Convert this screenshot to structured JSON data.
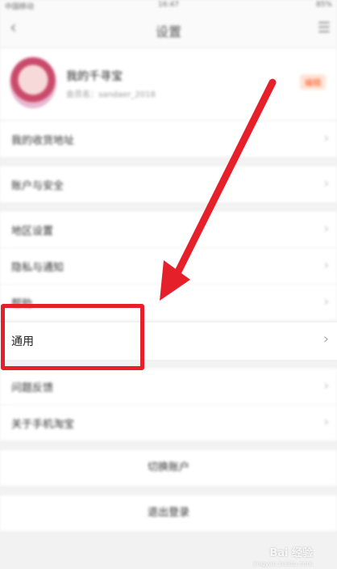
{
  "status_bar": {
    "carrier": "中国移动",
    "time": "16:47",
    "battery": "85%"
  },
  "nav": {
    "title": "设置",
    "back_icon": "chevron-left-icon",
    "menu_icon": "menu-icon"
  },
  "profile": {
    "name": "我的千寻宝",
    "subtitle": "会员名：sandaer_2018",
    "badge": "编辑"
  },
  "rows": {
    "address": "我的收货地址",
    "account_security": "账户与安全",
    "region": "地区设置",
    "privacy": "隐私与通知",
    "help": "帮助",
    "general": "通用",
    "feedback": "问题反馈",
    "about": "关于手机淘宝"
  },
  "buttons": {
    "switch_account": "切换账户",
    "logout": "退出登录"
  },
  "chevron": "›",
  "annotation": {
    "box_color": "#e6202a",
    "arrow_color": "#e6202a"
  },
  "watermark": {
    "brand": "Bai 经验",
    "url": "jingyan.baidu.com"
  }
}
